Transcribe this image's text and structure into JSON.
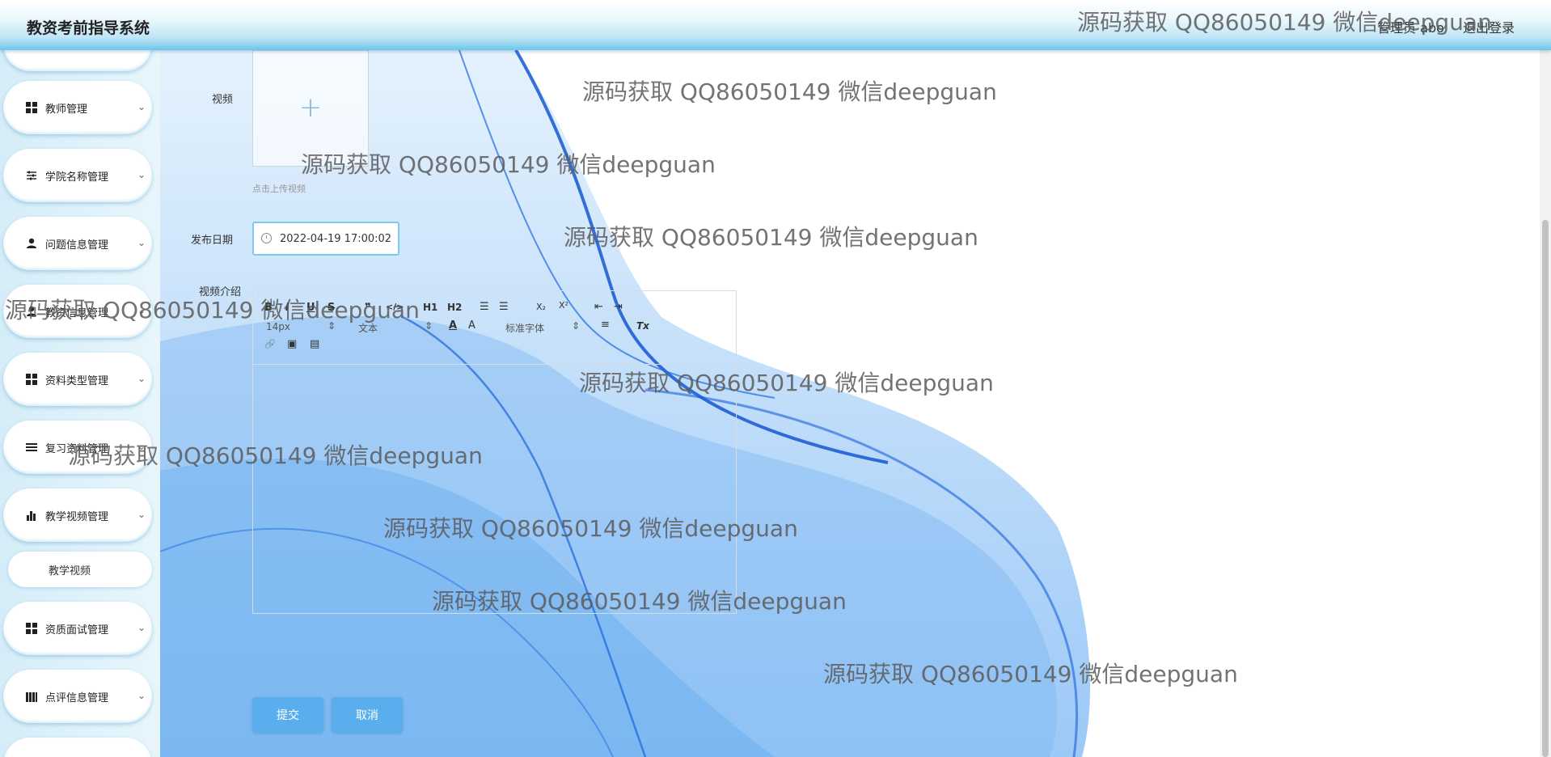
{
  "header": {
    "title": "教资考前指导系统",
    "user_label": "管理员 abo",
    "logout_label": "退出登录"
  },
  "sidebar": {
    "items": [
      {
        "label": "教师管理",
        "icon": "grid-icon"
      },
      {
        "label": "学院名称管理",
        "icon": "sliders-icon"
      },
      {
        "label": "问题信息管理",
        "icon": "user-icon"
      },
      {
        "label": "教资信息管理",
        "icon": "user-icon"
      },
      {
        "label": "资料类型管理",
        "icon": "grid-icon"
      },
      {
        "label": "复习资料管理",
        "icon": "list-icon"
      },
      {
        "label": "教学视频管理",
        "icon": "bar-chart-icon"
      },
      {
        "label": "资质面试管理",
        "icon": "grid-icon"
      },
      {
        "label": "点评信息管理",
        "icon": "book-icon"
      }
    ],
    "submenu": {
      "label": "教学视频"
    }
  },
  "form": {
    "video_label": "视频",
    "upload_plus": "+",
    "upload_hint": "点击上传视频",
    "date_label": "发布日期",
    "date_value": "2022-04-19 17:00:02",
    "intro_label": "视频介绍",
    "submit_label": "提交",
    "cancel_label": "取消"
  },
  "editor_toolbar": {
    "bold": "B",
    "italic": "I",
    "underline": "U",
    "strike": "S",
    "quote": "❞",
    "code": "</>",
    "h1": "H1",
    "h2": "H2",
    "ordered_list": "☰",
    "bullet_list": "☰",
    "subscript": "X₂",
    "superscript": "X²",
    "outdent": "⇤",
    "indent": "⇥",
    "font_size": "14px",
    "header_select": "文本",
    "font_family": "标准字体",
    "color": "A",
    "background": "A",
    "align": "≡",
    "clean": "Tx",
    "link": "🔗",
    "image": "▣",
    "video": "▤"
  },
  "watermark_text": "源码获取 QQ86050149 微信deepguan"
}
